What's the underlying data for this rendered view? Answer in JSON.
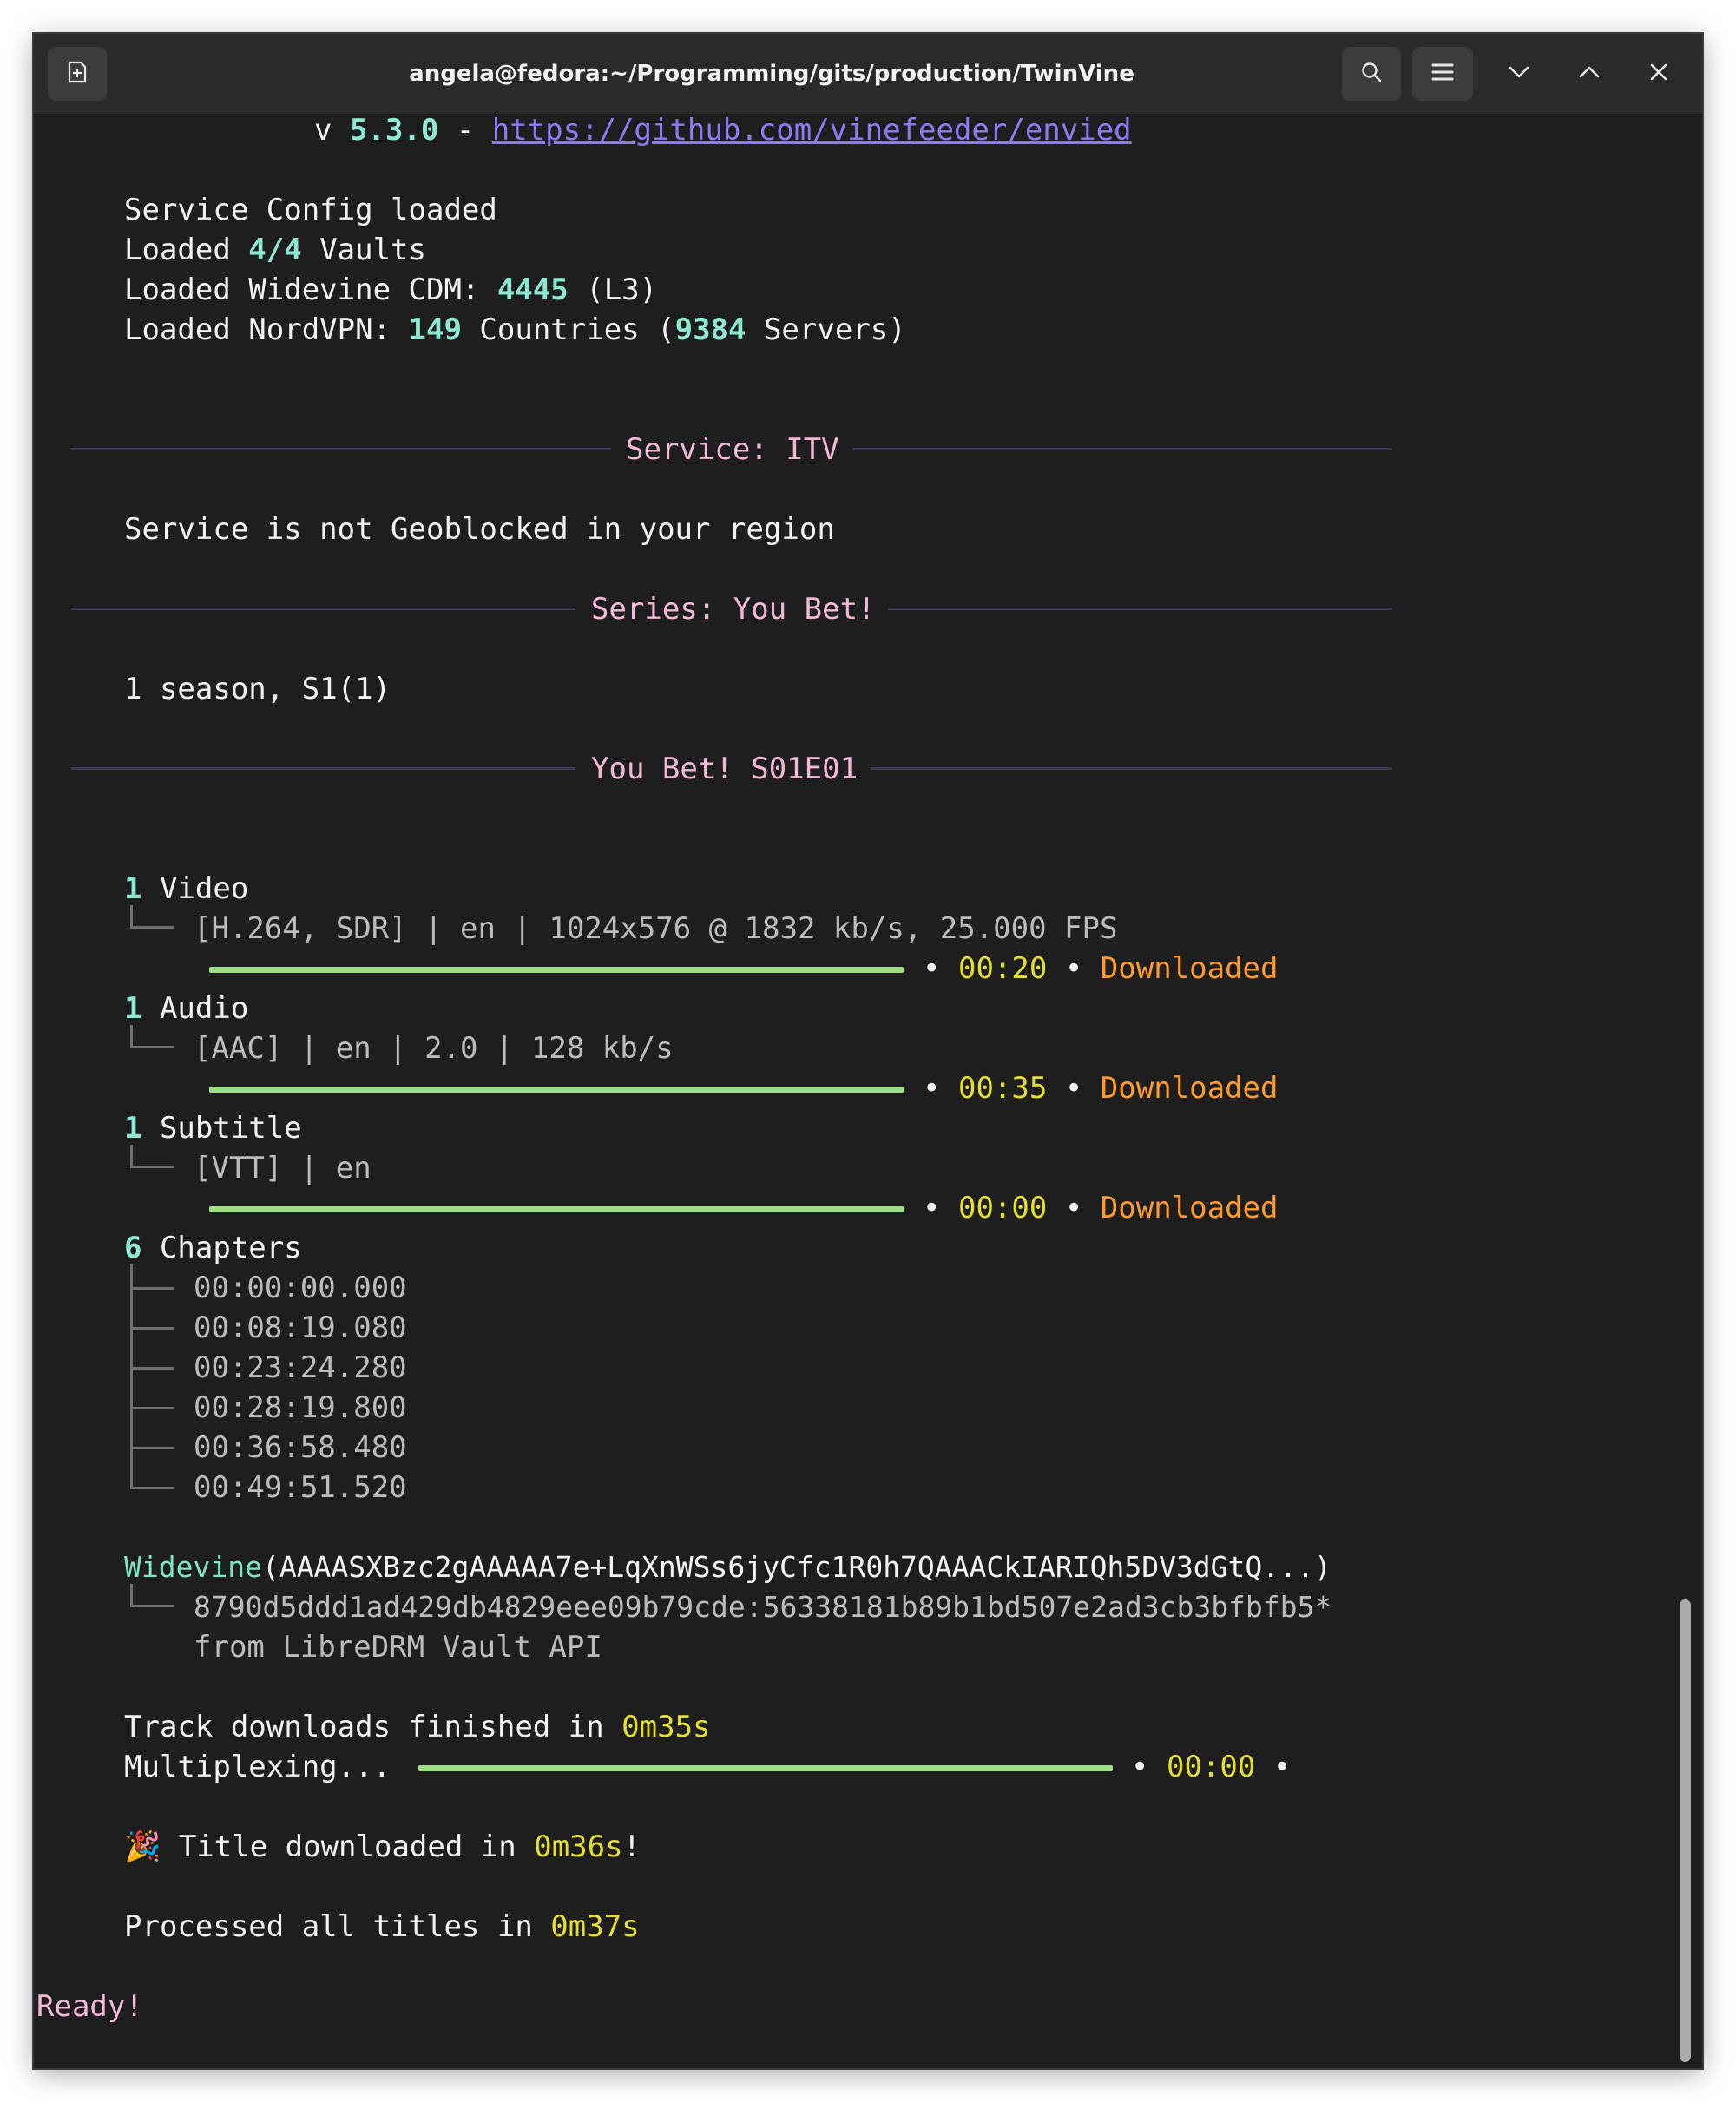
{
  "window": {
    "title": "angela@fedora:~/Programming/gits/production/TwinVine"
  },
  "icons": {
    "new_tab": "new-tab-icon",
    "search": "search-icon",
    "menu": "hamburger-menu-icon",
    "minimize": "chevron-down-icon",
    "maximize": "chevron-up-icon",
    "close": "close-icon"
  },
  "colors": {
    "background": "#1e1e1e",
    "accent_number": "#8ee8d2",
    "pink": "#f4b8d8",
    "yellow": "#e6df2e",
    "orange": "#ff9a2e",
    "link": "#8b7cf6",
    "progress": "#9ede84"
  },
  "terminal": {
    "version_prefix": "v ",
    "version": "5.3.0",
    "version_sep": " - ",
    "url": "https://github.com/vinefeeder/envied",
    "service_config": "Service Config loaded",
    "vaults_prefix": "Loaded ",
    "vaults_count": "4/4",
    "vaults_suffix": " Vaults",
    "cdm_prefix": "Loaded Widevine CDM: ",
    "cdm_id": "4445",
    "cdm_suffix": " (L3)",
    "vpn_prefix": "Loaded NordVPN: ",
    "vpn_countries": "149",
    "vpn_mid": " Countries ",
    "vpn_paren": "(",
    "vpn_servers": "9384",
    "vpn_suffix": " Servers)",
    "rule_service": "Service: ITV",
    "geoblock": "Service is not Geoblocked in your region",
    "rule_series": "Series: You Bet!",
    "seasons": "1 season, S1(1)",
    "rule_episode": "You Bet! S01E01",
    "video_count": "1",
    "video_label": " Video",
    "video_detail": "[H.264, SDR] | en | 1024x576 @ 1832 kb/s, 25.000 FPS",
    "video_time": "00:20",
    "video_status": "Downloaded",
    "video_progress": 1.0,
    "audio_count": "1",
    "audio_label": " Audio",
    "audio_detail": "[AAC] | en | 2.0 | 128 kb/s",
    "audio_time": "00:35",
    "audio_status": "Downloaded",
    "audio_progress": 1.0,
    "subtitle_count": "1",
    "subtitle_label": " Subtitle",
    "subtitle_detail": "[VTT] | en",
    "subtitle_time": "00:00",
    "subtitle_status": "Downloaded",
    "subtitle_progress": 1.0,
    "bullet": "•",
    "chapters_count": "6",
    "chapters_label": " Chapters",
    "chapters": [
      "00:00:00.000",
      "00:08:19.080",
      "00:23:24.280",
      "00:28:19.800",
      "00:36:58.480",
      "00:49:51.520"
    ],
    "widevine_name": "Widevine",
    "widevine_pssh": "(AAAASXBzc2gAAAAA7e+LqXnWSs6jyCfc1R0h7QAAACkIARIQh5DV3dGtQ...)",
    "widevine_key": "8790d5ddd1ad429db4829eee09b79cde:56338181b89b1bd507e2ad3cb3bfbfb5*",
    "widevine_source": "from LibreDRM Vault API",
    "track_done_prefix": "Track downloads finished in ",
    "track_done_time": "0m35s",
    "mux_label": "Multiplexing...",
    "mux_time": "00:00",
    "mux_progress": 1.0,
    "party_emoji": "🎉",
    "title_done_prefix": " Title downloaded in ",
    "title_done_time": "0m36s",
    "title_done_suffix": "!",
    "all_done_prefix": "Processed all titles in ",
    "all_done_time": "0m37s",
    "ready": "Ready!"
  }
}
